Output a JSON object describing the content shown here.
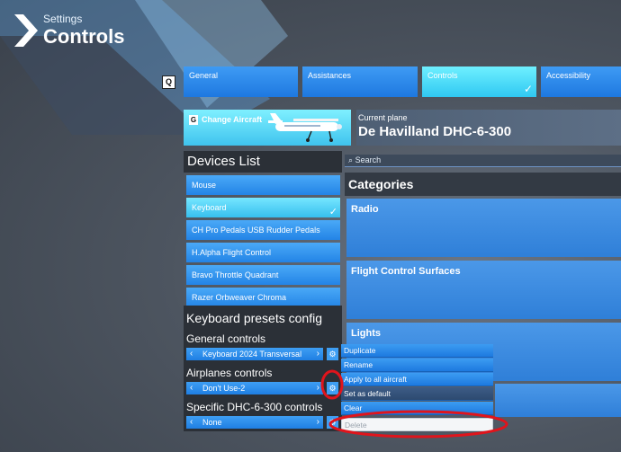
{
  "header": {
    "section": "Settings",
    "title": "Controls"
  },
  "tab_hotkey": "Q",
  "tabs": [
    {
      "label": "General",
      "active": false
    },
    {
      "label": "Assistances",
      "active": false
    },
    {
      "label": "Controls",
      "active": true
    },
    {
      "label": "Accessibility",
      "active": false
    }
  ],
  "aircraft": {
    "hotkey": "G",
    "change_label": "Change Aircraft",
    "current_label": "Current plane",
    "current_name": "De Havilland DHC-6-300"
  },
  "devices": {
    "title": "Devices List",
    "items": [
      {
        "label": "Mouse",
        "selected": false
      },
      {
        "label": "Keyboard",
        "selected": true
      },
      {
        "label": "CH Pro Pedals USB Rudder Pedals",
        "selected": false
      },
      {
        "label": "H.Alpha Flight Control",
        "selected": false
      },
      {
        "label": "Bravo Throttle Quadrant",
        "selected": false
      },
      {
        "label": "Razer Orbweaver Chroma",
        "selected": false
      }
    ]
  },
  "search": {
    "placeholder": "Search",
    "icon": "search-icon"
  },
  "categories": {
    "title": "Categories",
    "items": [
      "Radio",
      "Flight Control Surfaces",
      "Lights"
    ]
  },
  "presets": {
    "title": "Keyboard presets config",
    "general_label": "General controls",
    "general_value": "Keyboard 2024 Transversal",
    "airplanes_label": "Airplanes controls",
    "airplanes_value": "Don't Use-2",
    "specific_label": "Specific DHC-6-300 controls",
    "specific_value": "None"
  },
  "context_menu": {
    "items": [
      "Duplicate",
      "Rename",
      "Apply to all aircraft",
      "Set as default",
      "Clear",
      "Delete"
    ]
  },
  "colors": {
    "accent": "#2384e6",
    "accent_active": "#37bfee",
    "annotation": "#e0141c"
  }
}
